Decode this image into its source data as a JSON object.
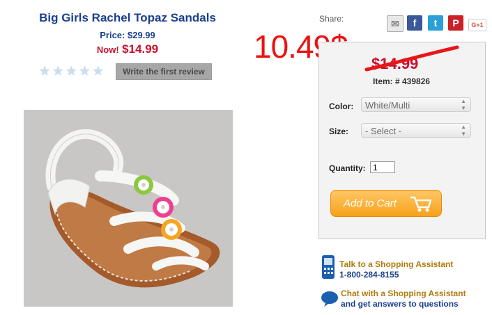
{
  "product": {
    "title": "Big Girls Rachel Topaz Sandals",
    "price_label": "Price:",
    "price_value": "$29.99",
    "now_label": "Now!",
    "now_value": "$14.99",
    "review_button": "Write the first review",
    "rating_stars": 0,
    "rating_max": 5
  },
  "share": {
    "label": "Share:",
    "icons": [
      "email-icon",
      "facebook-icon",
      "twitter-icon",
      "pinterest-icon",
      "google-plus-icon"
    ],
    "gplus_text": "G+1"
  },
  "annotation": {
    "new_price": "10.49$"
  },
  "purchase": {
    "struck_price": "$14.99",
    "item_label": "Item: # 439826",
    "color_label": "Color:",
    "color_value": "White/Multi",
    "size_label": "Size:",
    "size_value": "- Select -",
    "quantity_label": "Quantity:",
    "quantity_value": "1",
    "cart_button": "Add to Cart"
  },
  "help": {
    "phone_title": "Talk to a Shopping Assistant",
    "phone_number": "1-800-284-8155",
    "chat_title": "Chat with a Shopping Assistant",
    "chat_sub": "and get answers to questions"
  },
  "colors": {
    "brand_blue": "#1b3f8f",
    "sale_red": "#c8102e",
    "annotation_red": "#ee1111",
    "cart_orange": "#f7a21a"
  }
}
